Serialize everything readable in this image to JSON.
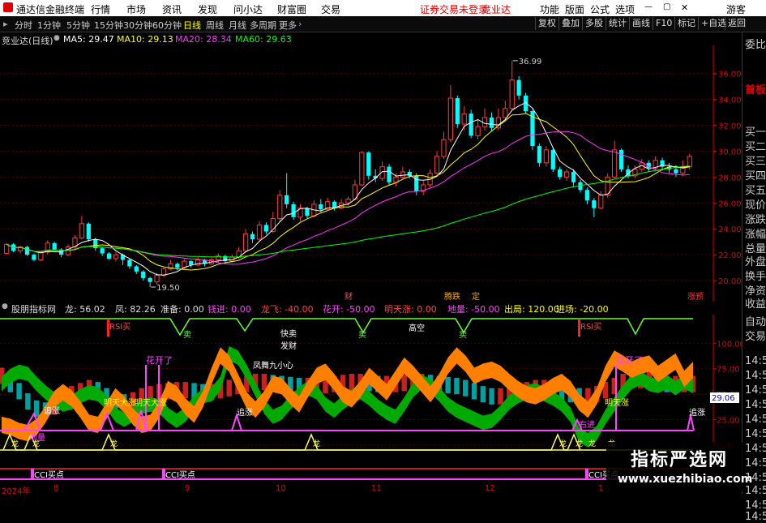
{
  "menubar": {
    "app_title": "通达信金融终端",
    "items": [
      "行情",
      "市场",
      "资讯",
      "发现",
      "问小达",
      "财富圈",
      "交易"
    ],
    "login_notice": "证券交易未登录",
    "login_brand": "竞业达",
    "right_items": [
      "功能",
      "版面",
      "公式",
      "选项"
    ],
    "guest": "游客"
  },
  "toolbar": {
    "periods": [
      "分时",
      "1分钟",
      "5分钟",
      "15分钟",
      "30分钟",
      "60分钟",
      "日线",
      "周线",
      "月线",
      "多周期",
      "更多"
    ],
    "active_period": "日线",
    "right_buttons": [
      "复权",
      "叠加",
      "多股",
      "统计",
      "画线",
      "F10",
      "标记",
      "+自选",
      "返回"
    ]
  },
  "ma_bar": {
    "title": "竞业达(日线)",
    "ma5": "MA5: 29.47",
    "ma10": "MA10: 29.13",
    "ma20": "MA20: 28.34",
    "ma60": "MA60: 29.63"
  },
  "colors": {
    "up": "#ff3b3b",
    "down": "#00ffff",
    "ma5": "#ffffff",
    "ma10": "#ffff00",
    "ma20": "#ff33ff",
    "ma60": "#00ff00",
    "grid": "#550000",
    "axis": "#e00000",
    "orange": "#ff7f00",
    "green": "#00aa00",
    "teal": "#00a0a0",
    "magenta": "#ff44ff",
    "yellow_line": "#ffff66"
  },
  "chart_data": [
    {
      "type": "candlestick",
      "yticks": [
        20.0,
        22.0,
        24.0,
        26.0,
        28.0,
        30.0,
        32.0,
        34.0,
        36.0
      ],
      "ylim": [
        19.0,
        37.8
      ],
      "annotations": {
        "high": "36.99",
        "low": "19.50"
      },
      "markers": [
        "财",
        "腾跌",
        "定",
        "涨预"
      ],
      "candles": [
        [
          22.1,
          22.8,
          22.0,
          22.9
        ],
        [
          22.8,
          22.3,
          22.2,
          22.9
        ],
        [
          22.3,
          22.6,
          22.1,
          22.7
        ],
        [
          22.6,
          22.0,
          21.9,
          22.7
        ],
        [
          22.0,
          21.6,
          21.5,
          22.1
        ],
        [
          21.6,
          22.2,
          21.5,
          22.3
        ],
        [
          22.2,
          22.9,
          22.0,
          23.1
        ],
        [
          22.9,
          22.4,
          22.3,
          23.0
        ],
        [
          22.4,
          22.0,
          21.8,
          22.5
        ],
        [
          22.0,
          22.6,
          21.9,
          22.8
        ],
        [
          22.6,
          23.3,
          22.4,
          23.5
        ],
        [
          23.3,
          24.4,
          23.2,
          25.0
        ],
        [
          24.4,
          23.2,
          23.0,
          24.5
        ],
        [
          23.2,
          22.5,
          22.3,
          23.3
        ],
        [
          22.5,
          22.1,
          21.9,
          22.6
        ],
        [
          22.1,
          21.7,
          21.6,
          22.2
        ],
        [
          21.7,
          22.0,
          21.5,
          22.2
        ],
        [
          22.0,
          21.6,
          21.2,
          22.1
        ],
        [
          21.6,
          21.1,
          20.9,
          21.7
        ],
        [
          21.1,
          20.7,
          20.5,
          21.2
        ],
        [
          20.7,
          20.2,
          20.0,
          20.8
        ],
        [
          20.2,
          19.9,
          19.5,
          20.3
        ],
        [
          19.9,
          20.4,
          19.7,
          20.6
        ],
        [
          20.4,
          20.9,
          20.3,
          21.0
        ],
        [
          20.9,
          21.3,
          20.8,
          21.6
        ],
        [
          21.3,
          21.0,
          20.8,
          21.4
        ],
        [
          21.0,
          21.5,
          20.9,
          21.7
        ],
        [
          21.5,
          21.2,
          21.0,
          21.6
        ],
        [
          21.2,
          21.6,
          21.1,
          21.8
        ],
        [
          21.6,
          21.3,
          21.1,
          21.7
        ],
        [
          21.3,
          21.6,
          21.2,
          21.8
        ],
        [
          21.6,
          21.9,
          21.4,
          22.1
        ],
        [
          21.9,
          21.5,
          21.3,
          22.0
        ],
        [
          21.5,
          21.8,
          21.4,
          22.0
        ],
        [
          21.8,
          22.3,
          21.7,
          22.6
        ],
        [
          22.3,
          23.6,
          22.2,
          24.0
        ],
        [
          23.6,
          23.2,
          22.9,
          23.8
        ],
        [
          23.2,
          24.3,
          23.1,
          24.6
        ],
        [
          24.3,
          23.8,
          23.6,
          24.5
        ],
        [
          23.8,
          24.8,
          23.7,
          25.3
        ],
        [
          24.8,
          26.6,
          24.6,
          27.0
        ],
        [
          26.6,
          25.9,
          25.6,
          28.3
        ],
        [
          25.9,
          24.9,
          24.7,
          26.1
        ],
        [
          24.9,
          25.6,
          24.6,
          25.9
        ],
        [
          25.6,
          25.0,
          24.8,
          25.7
        ],
        [
          25.0,
          25.9,
          24.9,
          26.2
        ],
        [
          25.9,
          25.5,
          25.3,
          26.3
        ],
        [
          25.5,
          26.1,
          25.4,
          26.4
        ],
        [
          26.1,
          25.6,
          25.4,
          26.2
        ],
        [
          25.6,
          26.0,
          25.5,
          26.3
        ],
        [
          26.0,
          26.3,
          25.8,
          26.5
        ],
        [
          26.3,
          27.4,
          26.2,
          27.8
        ],
        [
          27.4,
          29.9,
          27.3,
          30.0
        ],
        [
          29.9,
          28.1,
          27.8,
          30.0
        ],
        [
          28.1,
          27.9,
          27.6,
          28.6
        ],
        [
          27.9,
          28.8,
          27.7,
          29.2
        ],
        [
          28.8,
          27.6,
          27.4,
          29.0
        ],
        [
          27.6,
          28.0,
          27.3,
          28.3
        ],
        [
          28.0,
          28.4,
          27.8,
          28.8
        ],
        [
          28.4,
          28.1,
          27.9,
          28.6
        ],
        [
          28.1,
          26.9,
          26.6,
          28.3
        ],
        [
          26.9,
          27.4,
          26.6,
          27.7
        ],
        [
          27.4,
          28.3,
          27.2,
          28.6
        ],
        [
          28.3,
          29.6,
          28.1,
          30.0
        ],
        [
          29.6,
          30.9,
          29.4,
          31.5
        ],
        [
          30.9,
          34.1,
          30.7,
          35.1
        ],
        [
          34.1,
          32.1,
          31.8,
          34.3
        ],
        [
          32.1,
          32.9,
          31.6,
          33.5
        ],
        [
          32.9,
          31.2,
          31.0,
          33.2
        ],
        [
          31.2,
          31.9,
          30.9,
          32.5
        ],
        [
          31.9,
          32.6,
          31.6,
          33.3
        ],
        [
          32.6,
          31.8,
          31.5,
          33.0
        ],
        [
          31.8,
          32.6,
          31.6,
          33.3
        ],
        [
          32.6,
          33.3,
          32.4,
          33.9
        ],
        [
          33.3,
          35.5,
          33.2,
          36.99
        ],
        [
          35.5,
          34.3,
          34.0,
          35.8
        ],
        [
          34.3,
          33.1,
          32.9,
          34.5
        ],
        [
          33.1,
          30.4,
          30.1,
          33.2
        ],
        [
          30.4,
          29.1,
          28.8,
          30.6
        ],
        [
          29.1,
          30.1,
          28.8,
          30.4
        ],
        [
          30.1,
          28.6,
          28.4,
          30.3
        ],
        [
          28.6,
          28.0,
          27.8,
          28.8
        ],
        [
          28.0,
          28.4,
          27.7,
          28.6
        ],
        [
          28.4,
          27.6,
          27.3,
          28.6
        ],
        [
          27.6,
          27.0,
          26.8,
          27.8
        ],
        [
          27.0,
          26.2,
          25.9,
          27.2
        ],
        [
          26.2,
          25.6,
          24.9,
          26.4
        ],
        [
          25.6,
          26.6,
          25.5,
          26.9
        ],
        [
          26.6,
          28.0,
          26.4,
          28.3
        ],
        [
          28.0,
          30.1,
          27.9,
          30.8
        ],
        [
          30.1,
          28.6,
          28.4,
          30.2
        ],
        [
          28.6,
          28.1,
          27.9,
          28.9
        ],
        [
          28.1,
          28.6,
          27.9,
          28.9
        ],
        [
          28.6,
          29.1,
          28.4,
          29.4
        ],
        [
          29.1,
          28.7,
          28.4,
          29.3
        ],
        [
          28.7,
          29.3,
          28.5,
          29.6
        ],
        [
          29.3,
          28.8,
          28.5,
          29.5
        ],
        [
          28.8,
          28.6,
          28.3,
          29.1
        ],
        [
          28.6,
          28.3,
          28.0,
          28.9
        ],
        [
          28.3,
          28.8,
          28.1,
          29.3
        ],
        [
          28.8,
          29.6,
          28.6,
          29.8
        ]
      ]
    },
    {
      "type": "area",
      "title": "股朋指标网",
      "yticks": [
        0.0,
        25.0,
        50.0,
        75.0,
        100.0
      ],
      "ylim": [
        -38,
        128
      ],
      "current_value": "29.06",
      "labels": [
        "RSI买",
        "RSI买",
        "卖",
        "卖",
        "卖",
        "快卖",
        "发财",
        "高空",
        "凤舞九小心",
        "花开了",
        "花开了",
        "明天大涨",
        "明天大涨",
        "明天涨",
        "追涨",
        "追涨",
        "追涨",
        "地量",
        "CCI买点",
        "CCI买点",
        "CCI买点",
        "龙",
        "龙",
        "龙",
        "龙",
        "龙",
        "龙",
        "龙",
        "龙",
        "右进"
      ],
      "series": [
        {
          "name": "orange",
          "values": [
            20,
            18,
            14,
            12,
            18,
            30,
            45,
            52,
            46,
            35,
            22,
            20,
            34,
            48,
            40,
            28,
            20,
            22,
            35,
            55,
            50,
            38,
            30,
            45,
            68,
            88,
            80,
            62,
            44,
            35,
            45,
            60,
            58,
            48,
            40,
            55,
            68,
            72,
            62,
            50,
            45,
            55,
            68,
            60,
            52,
            65,
            78,
            70,
            60,
            50,
            62,
            78,
            88,
            80,
            68,
            72,
            74,
            70,
            62,
            55,
            50,
            48,
            52,
            58,
            62,
            55,
            42,
            35,
            48,
            70,
            85,
            80,
            74,
            78,
            80,
            70,
            76,
            82,
            65,
            74
          ]
        },
        {
          "name": "green",
          "values": [
            60,
            68,
            72,
            70,
            60,
            52,
            45,
            40,
            42,
            48,
            52,
            50,
            42,
            30,
            25,
            30,
            38,
            40,
            38,
            30,
            24,
            30,
            42,
            48,
            50,
            60,
            90,
            86,
            72,
            55,
            38,
            28,
            32,
            42,
            50,
            56,
            52,
            40,
            34,
            42,
            48,
            52,
            46,
            38,
            32,
            28,
            40,
            54,
            62,
            58,
            50,
            40,
            34,
            30,
            26,
            22,
            24,
            32,
            42,
            48,
            52,
            54,
            50,
            46,
            40,
            30,
            10,
            5,
            12,
            28,
            40,
            52,
            62,
            66,
            60,
            58,
            62,
            56,
            62,
            58
          ]
        },
        {
          "name": "teal",
          "values": [
            70,
            62,
            55,
            45,
            38,
            36,
            40,
            48,
            52,
            55,
            58,
            56,
            50,
            46,
            44,
            46,
            50,
            52,
            54,
            55,
            56,
            56,
            55,
            54,
            54,
            56,
            58,
            60,
            62,
            64,
            64,
            63,
            62,
            61,
            60,
            60,
            60,
            61,
            62,
            63,
            64,
            64,
            63,
            62,
            62,
            62,
            63,
            63,
            64,
            63,
            62,
            61,
            60,
            58,
            55,
            52,
            50,
            50,
            52,
            54,
            56,
            58,
            58,
            56,
            54,
            52,
            50,
            50,
            52,
            56,
            60,
            64,
            66,
            66,
            66,
            64,
            62,
            62,
            62,
            62
          ]
        }
      ]
    }
  ],
  "ind_bar": {
    "title": "股朋指标网",
    "long": "龙: 56.02",
    "feng": "凤: 82.26",
    "zhunbei": "准备: 0.00",
    "qianjin": "钱进: 0.00",
    "longfei": "龙飞: -40.00",
    "huakai": "花开: -50.00",
    "mingtianzhang": "明天涨: 0.00",
    "diliang": "地量: -50.00",
    "chuju": "出局: 120.00",
    "jinchang": "进场: -20.00"
  },
  "right_panel": {
    "items": [
      "委比",
      "首板",
      "买一",
      "买二",
      "买三",
      "买四",
      "买五",
      "现价",
      "涨跌",
      "涨幅",
      "总量",
      "外盘",
      "换手",
      "净资",
      "收益",
      "自动",
      "交易",
      "14:5",
      "14:5",
      "14:5",
      "14:5",
      "14:5",
      "14:5",
      "14:5",
      "14:5",
      "14:5",
      "14:5",
      "14:5",
      "14:5"
    ]
  },
  "date_axis": [
    "2024年",
    "8",
    "9",
    "10",
    "11",
    "12",
    "1"
  ],
  "watermark": {
    "line1": "指标严选网",
    "line2": "www.xuezhibiao.com"
  }
}
